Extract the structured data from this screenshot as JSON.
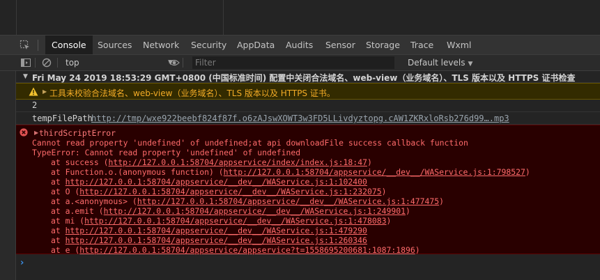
{
  "tabs": [
    "Console",
    "Sources",
    "Network",
    "Security",
    "AppData",
    "Audits",
    "Sensor",
    "Storage",
    "Trace",
    "Wxml"
  ],
  "toolbar": {
    "context": "top",
    "filter_placeholder": "Filter",
    "levels": "Default levels"
  },
  "messages": {
    "group_header": "Fri May 24 2019 18:53:29 GMT+0800 (中国标准时间) 配置中关闭合法域名、web-view（业务域名）、TLS 版本以及 HTTPS 证书检查",
    "warning": "工具未校验合法域名、web-view（业务域名）、TLS 版本以及 HTTPS 证书。",
    "number": "2",
    "temp_label": "tempFilePath",
    "temp_path": "http://tmp/wxe922beebf824f87f.o6zAJswXOWT3w3FD5LLivdyztopg.cAW1ZKRxloRsb276d99….mp3"
  },
  "error": {
    "title": "thirdScriptError",
    "line1": "Cannot read property 'undefined' of undefined;at api downloadFile success callback function",
    "line2": "TypeError: Cannot read property 'undefined' of undefined",
    "frames": [
      {
        "pre": "at success (",
        "link": "http://127.0.0.1:58704/appservice/index/index.js:18:47",
        "post": ")"
      },
      {
        "pre": "at Function.o.(anonymous function) (",
        "link": "http://127.0.0.1:58704/appservice/__dev__/WAService.js:1:798527",
        "post": ")"
      },
      {
        "pre": "at ",
        "link": "http://127.0.0.1:58704/appservice/__dev__/WAService.js:1:102400",
        "post": ""
      },
      {
        "pre": "at O (",
        "link": "http://127.0.0.1:58704/appservice/__dev__/WAService.js:1:232075",
        "post": ")"
      },
      {
        "pre": "at a.<anonymous> (",
        "link": "http://127.0.0.1:58704/appservice/__dev__/WAService.js:1:477475",
        "post": ")"
      },
      {
        "pre": "at a.emit (",
        "link": "http://127.0.0.1:58704/appservice/__dev__/WAService.js:1:249901",
        "post": ")"
      },
      {
        "pre": "at mi (",
        "link": "http://127.0.0.1:58704/appservice/__dev__/WAService.js:1:478083",
        "post": ")"
      },
      {
        "pre": "at ",
        "link": "http://127.0.0.1:58704/appservice/__dev__/WAService.js:1:479290",
        "post": ""
      },
      {
        "pre": "at ",
        "link": "http://127.0.0.1:58704/appservice/__dev__/WAService.js:1:260346",
        "post": ""
      },
      {
        "pre": "at e (",
        "link": "http://127.0.0.1:58704/appservice/appservice?t=1558695200681:1087:1896",
        "post": ")"
      }
    ]
  },
  "icons": {
    "inspect": "inspect-element-icon",
    "sidebar": "sidebar-toggle-icon",
    "clear": "clear-console-icon",
    "eye": "live-expression-eye-icon",
    "warning": "warning-icon",
    "error": "error-icon",
    "prompt": "console-prompt-caret-icon"
  },
  "colors": {
    "error_text": "#ff6b6b",
    "warning_text": "#f2ab26",
    "prompt": "#3a8ee6"
  }
}
